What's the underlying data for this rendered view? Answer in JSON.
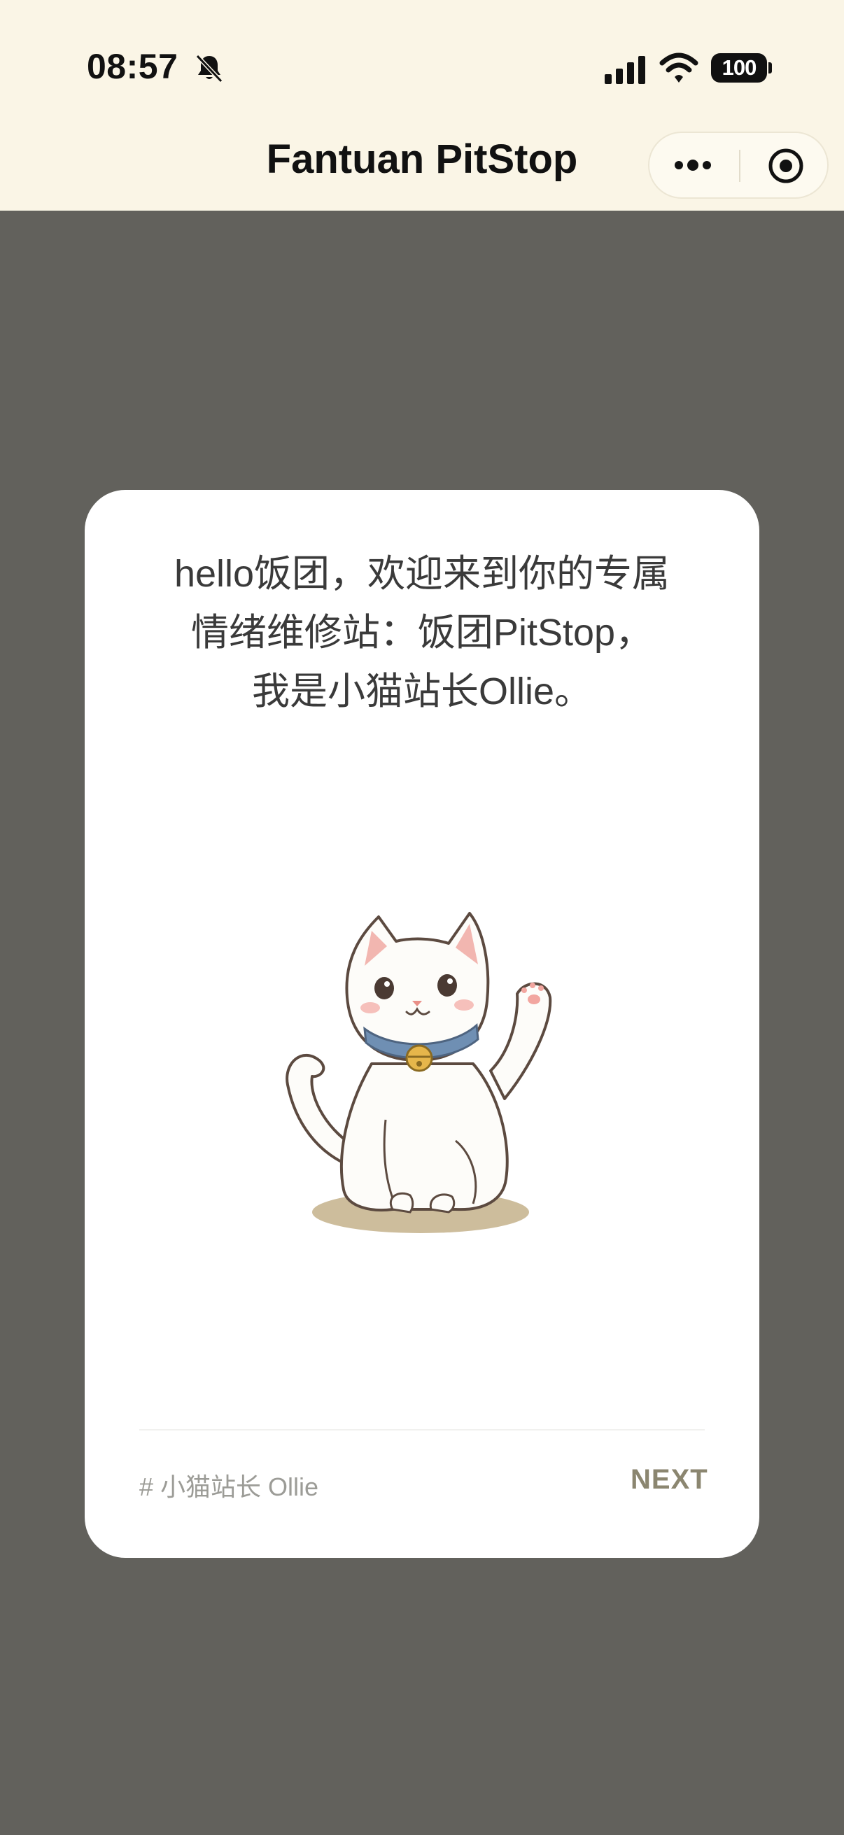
{
  "status_bar": {
    "time": "08:57",
    "battery_level": "100",
    "icons": [
      "bell-off-icon",
      "cellular-signal-icon",
      "wifi-icon",
      "battery-icon"
    ]
  },
  "nav": {
    "title": "Fantuan PitStop",
    "capsule_icons": [
      "more-icon",
      "target-icon"
    ]
  },
  "card": {
    "lines": [
      "hello饭团，欢迎来到你的专属",
      "情绪维修站：饭团PitStop，",
      "我是小猫站长Ollie。"
    ],
    "illustration": "waving-cat-illustration",
    "tag": "# 小猫站长 Ollie",
    "next_label": "NEXT"
  },
  "colors": {
    "top_bar_bg": "#faf5e6",
    "overlay_bg": "#62615c",
    "card_bg": "#ffffff",
    "next_text": "#8b8670",
    "tag_text": "#9c9c97"
  }
}
